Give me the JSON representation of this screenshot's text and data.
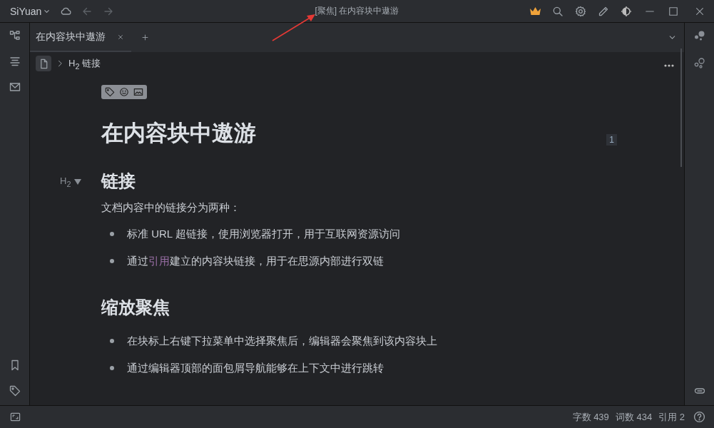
{
  "titlebar": {
    "app_name": "SiYuan",
    "title_prefix": "[聚焦]",
    "title": "在内容块中遨游"
  },
  "tabs": [
    {
      "label": "在内容块中遨游",
      "selected": true
    }
  ],
  "breadcrumb": {
    "text": "H$_{2}$ 链接"
  },
  "document": {
    "title": "在内容块中遨游",
    "ref_count": "1",
    "blocks": [
      {
        "kind": "heading",
        "gutter": "H$_{2}$",
        "text": "链接"
      },
      {
        "kind": "paragraph",
        "text": "文档内容中的链接分为两种："
      },
      {
        "kind": "list",
        "items": [
          [
            {
              "kind": "text",
              "text": "标准 URL 超链接，使用浏览器打开，用于互联网资源访问"
            }
          ],
          [
            {
              "kind": "text",
              "text": "通过"
            },
            {
              "kind": "ref",
              "text": "引用"
            },
            {
              "kind": "text",
              "text": "建立的内容块链接，用于在思源内部进行双链"
            }
          ]
        ]
      },
      {
        "kind": "heading",
        "text": "缩放聚焦"
      },
      {
        "kind": "list",
        "items": [
          [
            {
              "kind": "text",
              "text": "在块标上右键下拉菜单中选择聚焦后，编辑器会聚焦到该内容块上"
            }
          ],
          [
            {
              "kind": "text",
              "text": "通过编辑器顶部的面包屑导航能够在上下文中进行跳转"
            }
          ]
        ]
      }
    ]
  },
  "status_bar": {
    "counts": [
      "字数 439",
      "词数 434",
      "引用 2"
    ]
  }
}
